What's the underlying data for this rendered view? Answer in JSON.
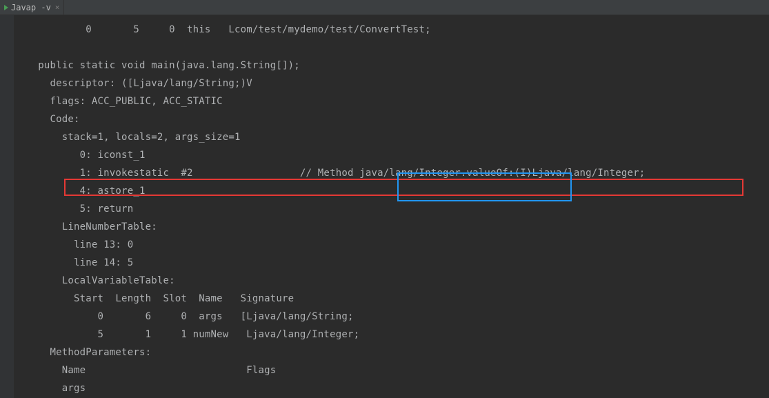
{
  "tab": {
    "title": "Javap -v",
    "close_glyph": "×"
  },
  "code": {
    "l0": "          0       5     0  this   Lcom/test/mydemo/test/ConvertTest;",
    "blank": "",
    "l1": "  public static void main(java.lang.String[]);",
    "l2": "    descriptor: ([Ljava/lang/String;)V",
    "l3": "    flags: ACC_PUBLIC, ACC_STATIC",
    "l4": "    Code:",
    "l5": "      stack=1, locals=2, args_size=1",
    "l6": "         0: iconst_1",
    "l7a": "         1: invokestatic  #2                  // Method ",
    "l7b": "java/lang/Integer.valueOf:",
    "l7c": "(I)Ljava/lang/Integer;",
    "l8": "         4: astore_1",
    "l9": "         5: return",
    "l10": "      LineNumberTable:",
    "l11": "        line 13: 0",
    "l12": "        line 14: 5",
    "l13": "      LocalVariableTable:",
    "l14": "        Start  Length  Slot  Name   Signature",
    "l15": "            0       6     0  args   [Ljava/lang/String;",
    "l16": "            5       1     1 numNew   Ljava/lang/Integer;",
    "l17": "    MethodParameters:",
    "l18": "      Name                           Flags",
    "l19": "      args"
  },
  "colors": {
    "bg": "#2b2b2b",
    "gutter": "#313335",
    "tab_bg": "#3c3f41",
    "text": "#afb1b3",
    "keyword": "#cc7832",
    "red_box": "#e53935",
    "blue_box": "#2196f3",
    "run_icon": "#499c54"
  }
}
